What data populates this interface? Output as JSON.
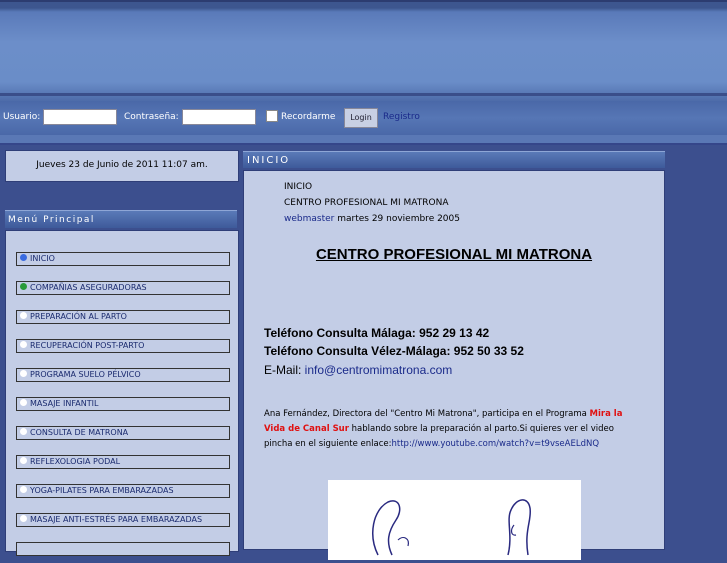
{
  "login": {
    "user_label": "Usuario:",
    "pass_label": "Contraseña:",
    "remember_label": "Recordarme",
    "login_button": "Login",
    "register_link": "Registro"
  },
  "date": "Jueves 23 de Junio de 2011 11:07 am.",
  "menu": {
    "title": "Menú Principal",
    "items": [
      {
        "label": "INICIO",
        "bullet": "blue"
      },
      {
        "label": "COMPAÑIAS ASEGURADORAS",
        "bullet": "green"
      },
      {
        "label": "PREPARACIÓN AL PARTO",
        "bullet": "white"
      },
      {
        "label": "RECUPERACIÓN POST-PARTO",
        "bullet": "white"
      },
      {
        "label": "PROGRAMA SUELO PÉLVICO",
        "bullet": "white"
      },
      {
        "label": "MASAJE INFANTIL",
        "bullet": "white"
      },
      {
        "label": "CONSULTA DE MATRONA",
        "bullet": "white"
      },
      {
        "label": "REFLEXOLOGIA PODAL",
        "bullet": "white"
      },
      {
        "label": "YOGA-PILATES PARA EMBARAZADAS",
        "bullet": "white"
      },
      {
        "label": "MASAJE ANTI-ESTRÉS PARA EMBARAZADAS",
        "bullet": "white"
      }
    ]
  },
  "content": {
    "header": "INICIO",
    "breadcrumb": "INICIO",
    "subtitle": "CENTRO PROFESIONAL MI MATRONA",
    "author": "webmaster",
    "date": " martes 29 noviembre 2005",
    "title": "CENTRO PROFESIONAL MI MATRONA",
    "phone1": "Teléfono Consulta Málaga: 952 29 13 42",
    "phone2": "Teléfono Consulta Vélez-Málaga: 952 50 33 52",
    "email_label": "E-Mail: ",
    "email": "info@centromimatrona.com",
    "para_1": "Ana Fernández, Directora del \"Centro Mi Matrona\", participa en el Programa ",
    "para_highlight": "Mira la Vida de Canal Sur",
    "para_2": " hablando sobre la preparación al parto.Si quieres ver el video pincha en el siguiente enlace:",
    "video_link": "http://www.youtube.com/watch?v=t9vseAELdNQ"
  }
}
